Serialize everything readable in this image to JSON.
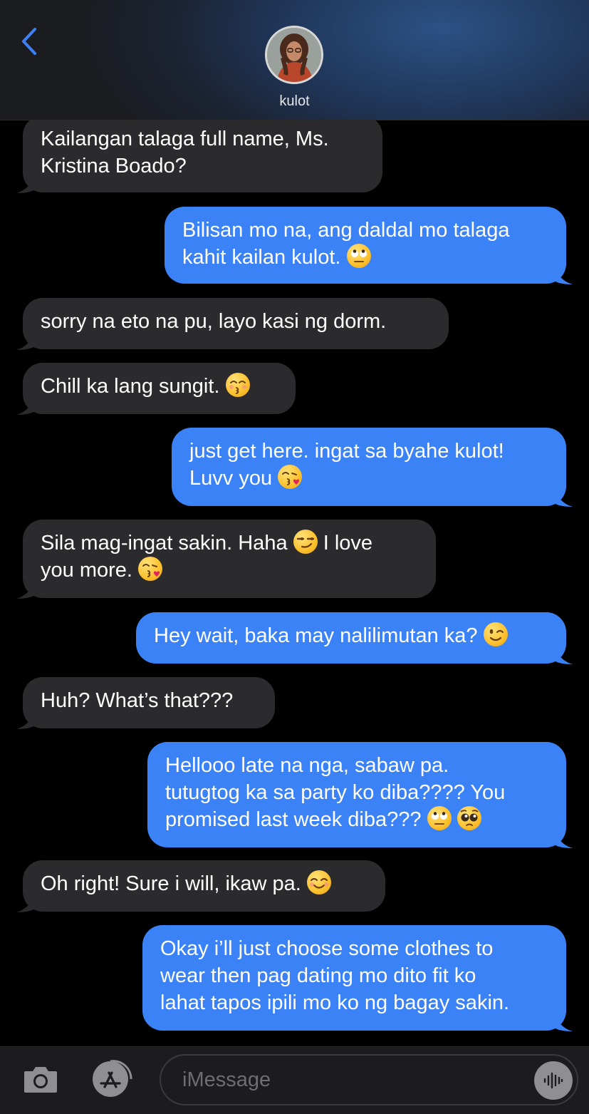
{
  "header": {
    "contact_name": "kulot"
  },
  "composer": {
    "placeholder": "iMessage"
  },
  "messages": [
    {
      "dir": "in",
      "lines": [
        "Kailangan talaga full name, Ms.",
        "Kristina Boado?"
      ]
    },
    {
      "dir": "out",
      "lines": [
        "Bilisan mo na, ang daldal mo talaga",
        "kahit kailan kulot."
      ],
      "emoji": [
        "rolling-eyes"
      ]
    },
    {
      "dir": "in",
      "lines": [
        "sorry na eto na pu, layo kasi ng dorm."
      ]
    },
    {
      "dir": "in",
      "lines": [
        "Chill ka lang sungit."
      ],
      "emoji": [
        "kissing-smiling-eyes"
      ]
    },
    {
      "dir": "out",
      "lines": [
        "just get here. ingat sa byahe kulot!",
        "Luvv you"
      ],
      "emoji": [
        "face-blowing-kiss"
      ]
    },
    {
      "dir": "in",
      "lines": [
        "Sila mag-ingat sakin. Haha",
        "I love",
        "you more."
      ],
      "emoji": [
        "smirking-face",
        "face-blowing-kiss"
      ]
    },
    {
      "dir": "out",
      "lines": [
        "Hey wait, baka may nalilimutan ka?"
      ],
      "emoji": [
        "winking-face"
      ]
    },
    {
      "dir": "in",
      "lines": [
        "Huh? What’s that???"
      ]
    },
    {
      "dir": "out",
      "lines": [
        "Hellooo late na nga, sabaw pa.",
        "tutugtog ka sa party ko diba???? You",
        "promised last week diba???"
      ],
      "emoji": [
        "rolling-eyes",
        "pleading-face"
      ]
    },
    {
      "dir": "in",
      "lines": [
        "Oh right! Sure i will, ikaw pa."
      ],
      "emoji": [
        "smiling-face"
      ]
    },
    {
      "dir": "out",
      "lines": [
        "Okay i’ll just choose some clothes to",
        "wear then pag dating mo dito fit ko",
        "lahat tapos ipili mo ko ng bagay sakin."
      ]
    }
  ]
}
